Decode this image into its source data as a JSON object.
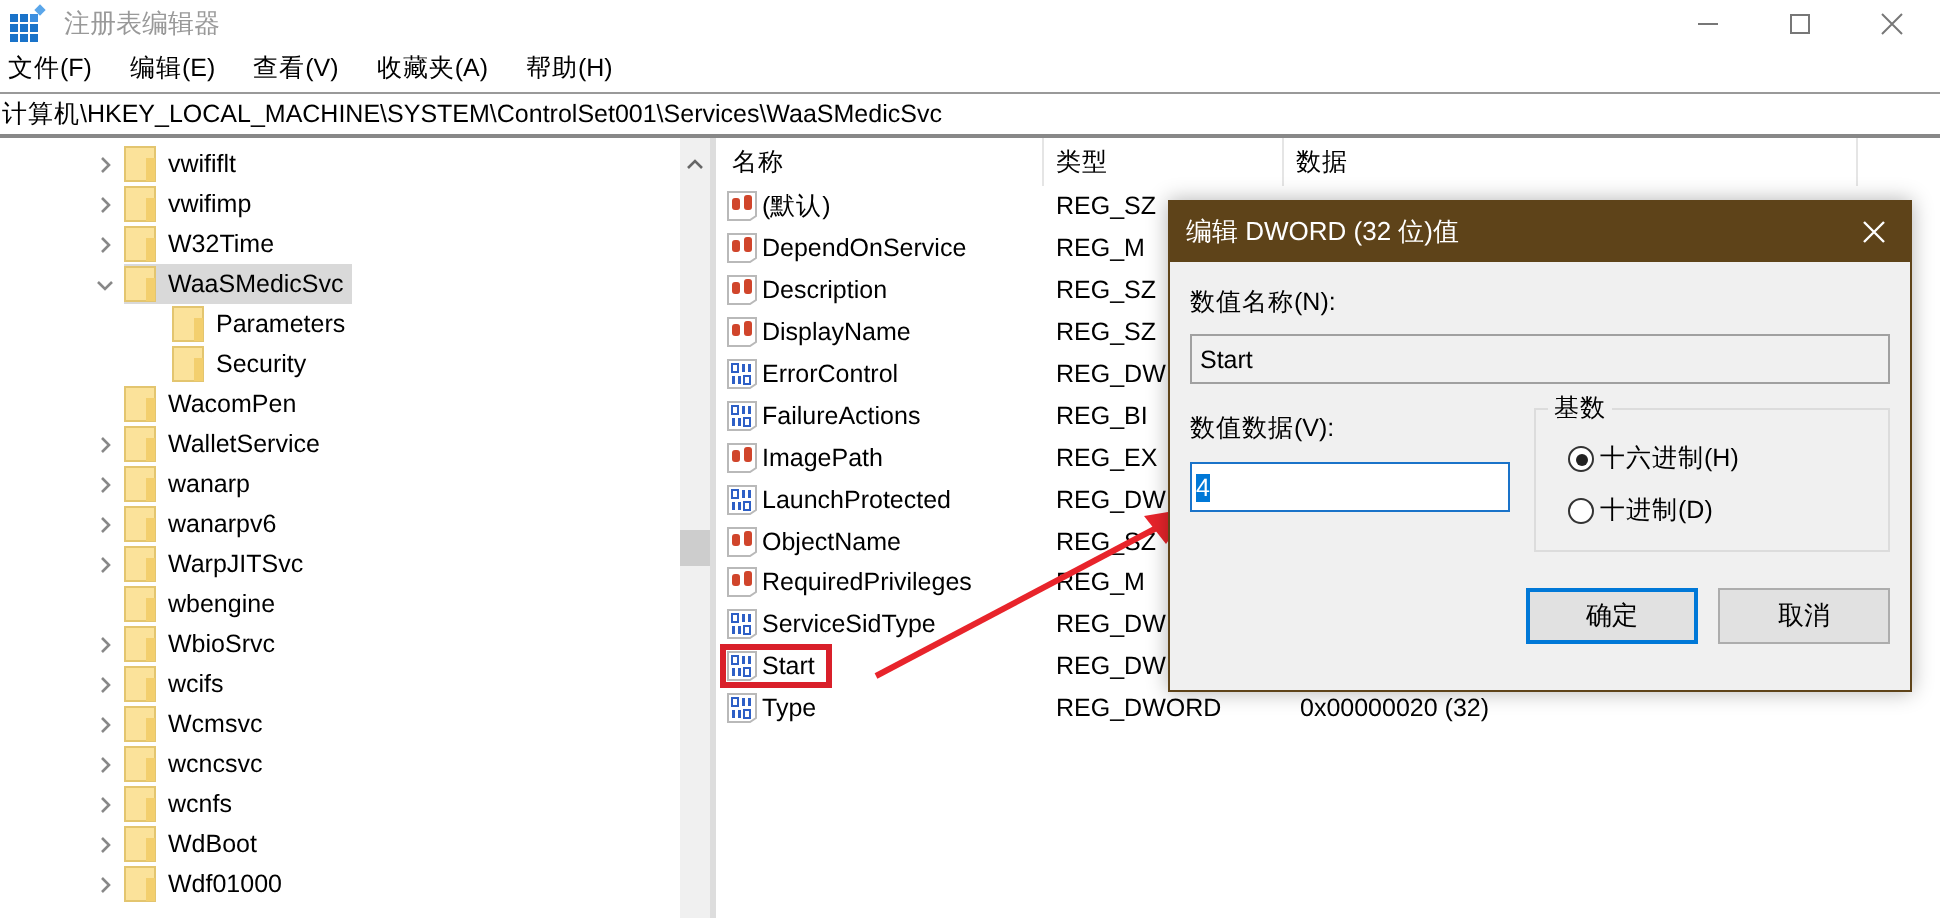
{
  "window": {
    "title": "注册表编辑器"
  },
  "menu": [
    "文件(F)",
    "编辑(E)",
    "查看(V)",
    "收藏夹(A)",
    "帮助(H)"
  ],
  "address": "计算机\\HKEY_LOCAL_MACHINE\\SYSTEM\\ControlSet001\\Services\\WaaSMedicSvc",
  "tree": [
    {
      "label": "vwififlt",
      "expanded": false,
      "selected": false
    },
    {
      "label": "vwifimp",
      "expanded": false,
      "selected": false
    },
    {
      "label": "W32Time",
      "expanded": false,
      "selected": false
    },
    {
      "label": "WaaSMedicSvc",
      "expanded": true,
      "selected": true,
      "children": [
        {
          "label": "Parameters",
          "selected": false
        },
        {
          "label": "Security",
          "selected": false
        }
      ]
    },
    {
      "label": "WacomPen",
      "selected": false
    },
    {
      "label": "WalletService",
      "expanded": false,
      "selected": false
    },
    {
      "label": "wanarp",
      "expanded": false,
      "selected": false
    },
    {
      "label": "wanarpv6",
      "expanded": false,
      "selected": false
    },
    {
      "label": "WarpJITSvc",
      "expanded": false,
      "selected": false
    },
    {
      "label": "wbengine",
      "selected": false
    },
    {
      "label": "WbioSrvc",
      "expanded": false,
      "selected": false
    },
    {
      "label": "wcifs",
      "expanded": false,
      "selected": false
    },
    {
      "label": "Wcmsvc",
      "expanded": false,
      "selected": false
    },
    {
      "label": "wcncsvc",
      "expanded": false,
      "selected": false
    },
    {
      "label": "wcnfs",
      "expanded": false,
      "selected": false
    },
    {
      "label": "WdBoot",
      "expanded": false,
      "selected": false
    },
    {
      "label": "Wdf01000",
      "expanded": false,
      "selected": false
    }
  ],
  "table": {
    "columns": [
      "名称",
      "类型",
      "数据"
    ],
    "rows": [
      {
        "kind": "string",
        "name": "(默认)",
        "type": "REG_SZ",
        "highlighted": false
      },
      {
        "kind": "string",
        "name": "DependOnService",
        "type": "REG_M",
        "highlighted": false
      },
      {
        "kind": "string",
        "name": "Description",
        "type": "REG_SZ",
        "highlighted": false
      },
      {
        "kind": "string",
        "name": "DisplayName",
        "type": "REG_SZ",
        "highlighted": false
      },
      {
        "kind": "binary",
        "name": "ErrorControl",
        "type": "REG_DW",
        "highlighted": false
      },
      {
        "kind": "binary",
        "name": "FailureActions",
        "type": "REG_BI",
        "highlighted": false
      },
      {
        "kind": "string",
        "name": "ImagePath",
        "type": "REG_EX",
        "highlighted": false
      },
      {
        "kind": "binary",
        "name": "LaunchProtected",
        "type": "REG_DW",
        "highlighted": false
      },
      {
        "kind": "string",
        "name": "ObjectName",
        "type": "REG_SZ",
        "highlighted": false
      },
      {
        "kind": "string",
        "name": "RequiredPrivileges",
        "type": "REG_M",
        "highlighted": false
      },
      {
        "kind": "binary",
        "name": "ServiceSidType",
        "type": "REG_DW",
        "highlighted": false
      },
      {
        "kind": "binary",
        "name": "Start",
        "type": "REG_DW",
        "highlighted": true
      },
      {
        "kind": "binary",
        "name": "Type",
        "type": "REG_DWORD",
        "data": "0x00000020 (32)",
        "highlighted": false
      }
    ]
  },
  "dialog": {
    "title": "编辑 DWORD (32 位)值",
    "name_label": "数值名称(N):",
    "name_value": "Start",
    "data_label": "数值数据(V):",
    "data_value": "4",
    "base": {
      "label": "基数",
      "options": [
        {
          "label": "十六进制(H)",
          "selected": true
        },
        {
          "label": "十进制(D)",
          "selected": false
        }
      ]
    },
    "buttons": [
      {
        "label": "确定",
        "default": true
      },
      {
        "label": "取消",
        "default": false
      }
    ]
  }
}
